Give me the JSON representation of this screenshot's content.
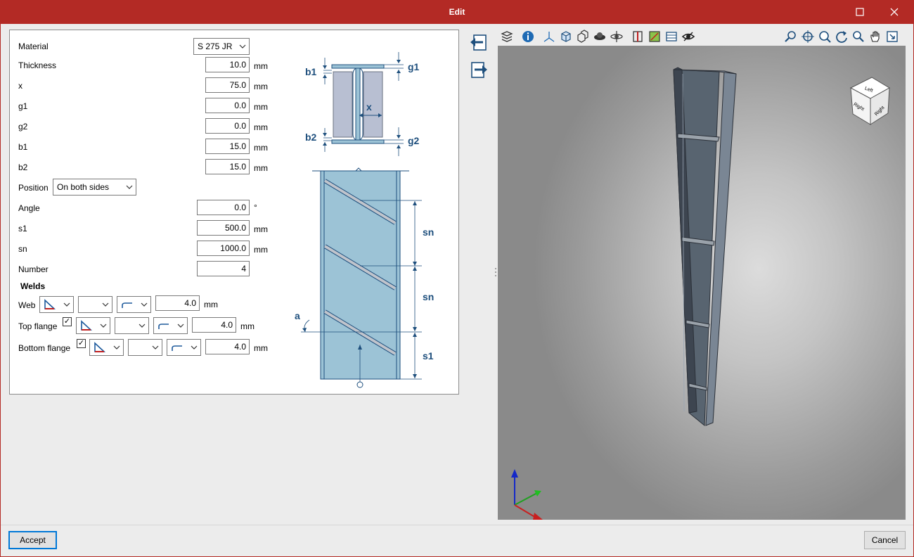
{
  "window": {
    "title": "Edit",
    "maximize_icon": "maximize-icon",
    "close_icon": "close-icon"
  },
  "form": {
    "material": {
      "label": "Material",
      "value": "S 275 JR"
    },
    "thickness": {
      "label": "Thickness",
      "value": "10.0",
      "unit": "mm"
    },
    "x": {
      "label": "x",
      "value": "75.0",
      "unit": "mm"
    },
    "g1": {
      "label": "g1",
      "value": "0.0",
      "unit": "mm"
    },
    "g2": {
      "label": "g2",
      "value": "0.0",
      "unit": "mm"
    },
    "b1": {
      "label": "b1",
      "value": "15.0",
      "unit": "mm"
    },
    "b2": {
      "label": "b2",
      "value": "15.0",
      "unit": "mm"
    },
    "position": {
      "label": "Position",
      "value": "On both sides"
    },
    "angle": {
      "label": "Angle",
      "value": "0.0",
      "unit": "°"
    },
    "s1": {
      "label": "s1",
      "value": "500.0",
      "unit": "mm"
    },
    "sn": {
      "label": "sn",
      "value": "1000.0",
      "unit": "mm"
    },
    "number": {
      "label": "Number",
      "value": "4"
    },
    "welds": {
      "heading": "Welds",
      "web": {
        "label": "Web",
        "value": "4.0",
        "unit": "mm"
      },
      "top_flange": {
        "label": "Top flange",
        "checked": true,
        "value": "4.0",
        "unit": "mm"
      },
      "bottom_flange": {
        "label": "Bottom flange",
        "checked": true,
        "value": "4.0",
        "unit": "mm"
      }
    }
  },
  "diagram": {
    "labels": {
      "b1": "b1",
      "g1": "g1",
      "x": "x",
      "b2": "b2",
      "g2": "g2",
      "sn_top": "sn",
      "sn_mid": "sn",
      "a": "a",
      "s1": "s1"
    }
  },
  "side_buttons": {
    "import_icon": "import-icon",
    "export_icon": "export-icon"
  },
  "viewer": {
    "toolbar_left_icons": [
      "layers-icon",
      "info-icon",
      "axes-icon",
      "solid-view-icon",
      "wireframe-view-icon",
      "render-icon",
      "orbit-icon",
      "section-icon",
      "grid-icon",
      "table-icon",
      "visibility-icon"
    ],
    "toolbar_right_icons": [
      "zoom-previous-icon",
      "zoom-extents-icon",
      "zoom-window-icon",
      "rotate-icon",
      "zoom-icon",
      "pan-icon",
      "fit-icon"
    ],
    "view_cube": {
      "face_top": "Left",
      "face_left": "Right",
      "face_right": "Right"
    }
  },
  "footer": {
    "accept_label": "Accept",
    "cancel_label": "Cancel"
  }
}
